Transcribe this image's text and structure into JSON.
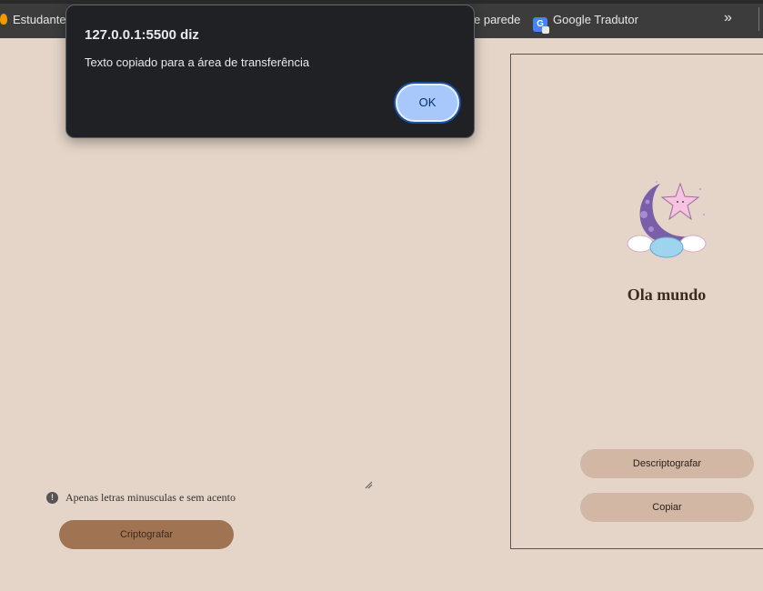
{
  "browser": {
    "bookmarks": {
      "estudante": "Estudante",
      "parede": "e parede",
      "tradutor": "Google Tradutor",
      "more": "»"
    }
  },
  "alert": {
    "title": "127.0.0.1:5500 diz",
    "message": "Texto copiado para a área de transferência",
    "ok_label": "OK"
  },
  "main": {
    "input_value": "",
    "hint_icon": "!",
    "hint_text": "Apenas letras minusculas e sem acento",
    "encrypt_label": "Criptografar"
  },
  "panel": {
    "title": "Ola mundo",
    "decrypt_label": "Descriptografar",
    "copy_label": "Copiar"
  },
  "colors": {
    "background": "#e4d5c8",
    "encrypt_button": "#a07452",
    "panel_button": "#d1b7a4",
    "alert_bg": "#202124",
    "alert_ok": "#a8c7fa"
  }
}
